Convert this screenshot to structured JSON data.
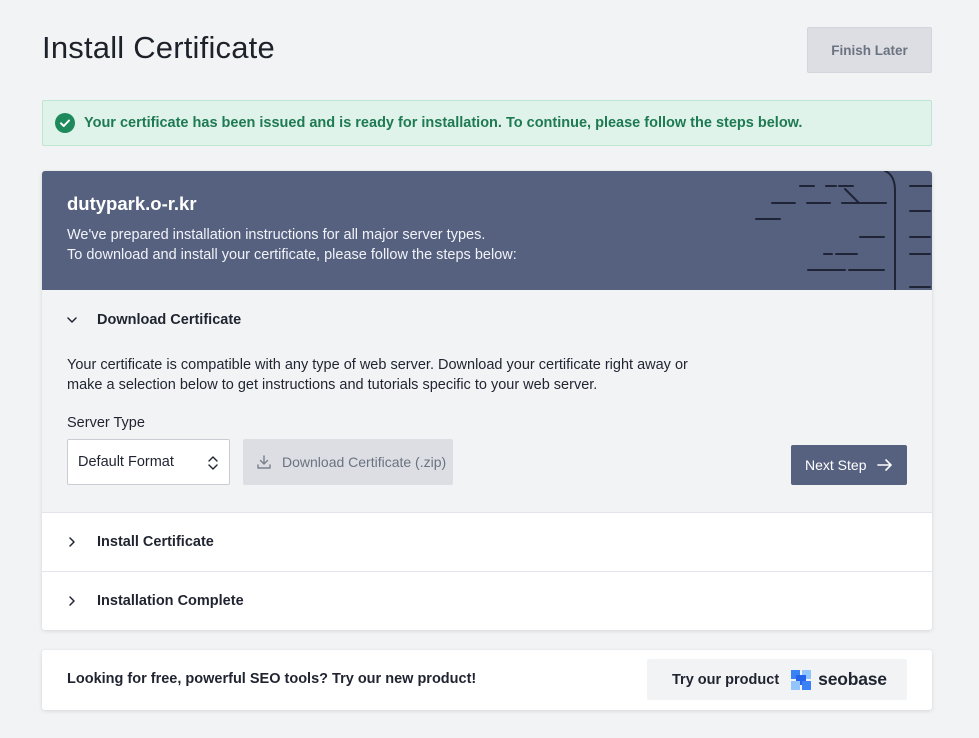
{
  "page": {
    "title": "Install Certificate",
    "finish_later_label": "Finish Later"
  },
  "alert": {
    "message": "Your certificate has been issued and is ready for installation. To continue, please follow the steps below.",
    "icon": "check-circle-icon",
    "color": "#1e8a5c"
  },
  "card": {
    "domain": "dutypark.o-r.kr",
    "intro_line_1": "We've prepared installation instructions for all major server types.",
    "intro_line_2": "To download and install your certificate, please follow the steps below:",
    "header_color": "#566180"
  },
  "steps": [
    {
      "title": "Download Certificate",
      "expanded": true,
      "description": "Your certificate is compatible with any type of web server. Download your certificate right away or make a selection below to get instructions and tutorials specific to your web server.",
      "server_type_label": "Server Type",
      "server_type_value": "Default Format",
      "download_label": "Download Certificate (.zip)",
      "next_label": "Next Step"
    },
    {
      "title": "Install Certificate",
      "expanded": false
    },
    {
      "title": "Installation Complete",
      "expanded": false
    }
  ],
  "promo": {
    "text": "Looking for free, powerful SEO tools? Try our new product!",
    "button_label": "Try our product",
    "brand": "seobase",
    "brand_color": "#3b82f6"
  }
}
